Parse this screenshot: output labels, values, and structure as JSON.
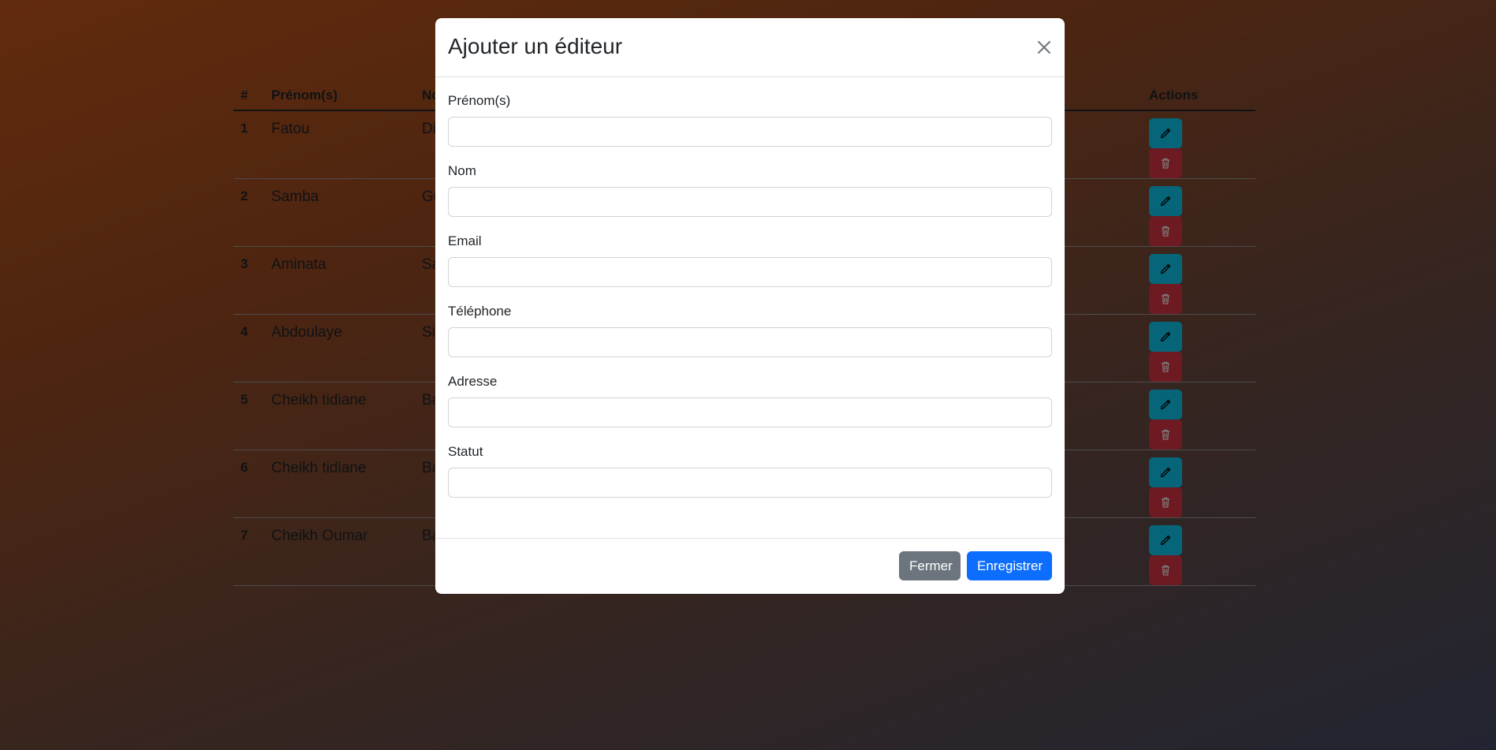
{
  "table": {
    "headers": [
      "#",
      "Prénom(s)",
      "No",
      "Actions"
    ],
    "rows": [
      {
        "idx": "1",
        "prenom": "Fatou",
        "nom": "Di"
      },
      {
        "idx": "2",
        "prenom": "Samba",
        "nom": "Gu"
      },
      {
        "idx": "3",
        "prenom": "Aminata",
        "nom": "Sa"
      },
      {
        "idx": "4",
        "prenom": "Abdoulaye",
        "nom": "Si"
      },
      {
        "idx": "5",
        "prenom": "Cheikh tidiane",
        "nom": "Ba"
      },
      {
        "idx": "6",
        "prenom": "Cheikh tidiane",
        "nom": "Ba"
      },
      {
        "idx": "7",
        "prenom": "Cheikh Oumar",
        "nom": "Ba"
      }
    ],
    "edit_icon": "pencil-icon",
    "delete_icon": "trash-icon",
    "colors": {
      "edit": "#0dcaf0",
      "delete": "#dc3545"
    }
  },
  "modal": {
    "title": "Ajouter un éditeur",
    "close_icon": "close-icon",
    "fields": [
      {
        "label": "Prénom(s)",
        "value": ""
      },
      {
        "label": "Nom",
        "value": ""
      },
      {
        "label": "Email",
        "value": ""
      },
      {
        "label": "Téléphone",
        "value": ""
      },
      {
        "label": "Adresse",
        "value": ""
      },
      {
        "label": "Statut",
        "value": ""
      }
    ],
    "close_label": "Fermer",
    "save_label": "Enregistrer",
    "colors": {
      "close": "#6c757d",
      "save": "#0d6efd"
    }
  }
}
